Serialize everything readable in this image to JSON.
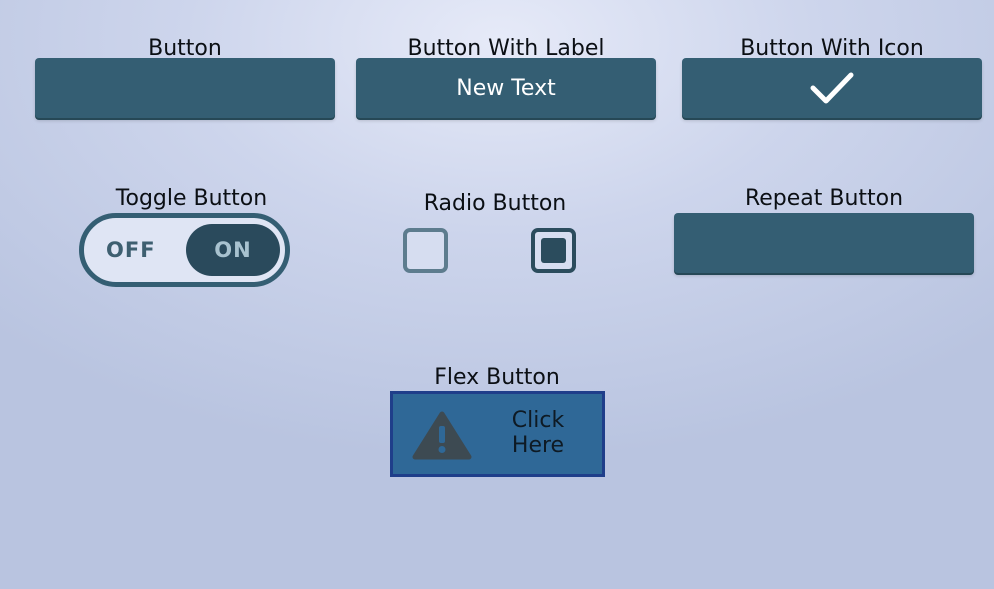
{
  "labels": {
    "button": "Button",
    "button_with_label": "Button With Label",
    "button_with_icon": "Button With Icon",
    "toggle_button": "Toggle Button",
    "radio_button": "Radio Button",
    "repeat_button": "Repeat Button",
    "flex_button": "Flex Button"
  },
  "buttons": {
    "button_with_label_text": "New Text",
    "button_with_icon_icon": "checkmark-icon"
  },
  "toggle": {
    "off_label": "OFF",
    "on_label": "ON",
    "state": "on"
  },
  "radios": [
    {
      "checked": false
    },
    {
      "checked": true
    }
  ],
  "flex": {
    "line1": "Click",
    "line2": "Here",
    "icon": "warning-icon"
  },
  "colors": {
    "button_fill": "#345e73",
    "flex_fill": "#2f6897",
    "flex_border": "#1f3e8a",
    "toggle_knob": "#2a4a5c"
  }
}
